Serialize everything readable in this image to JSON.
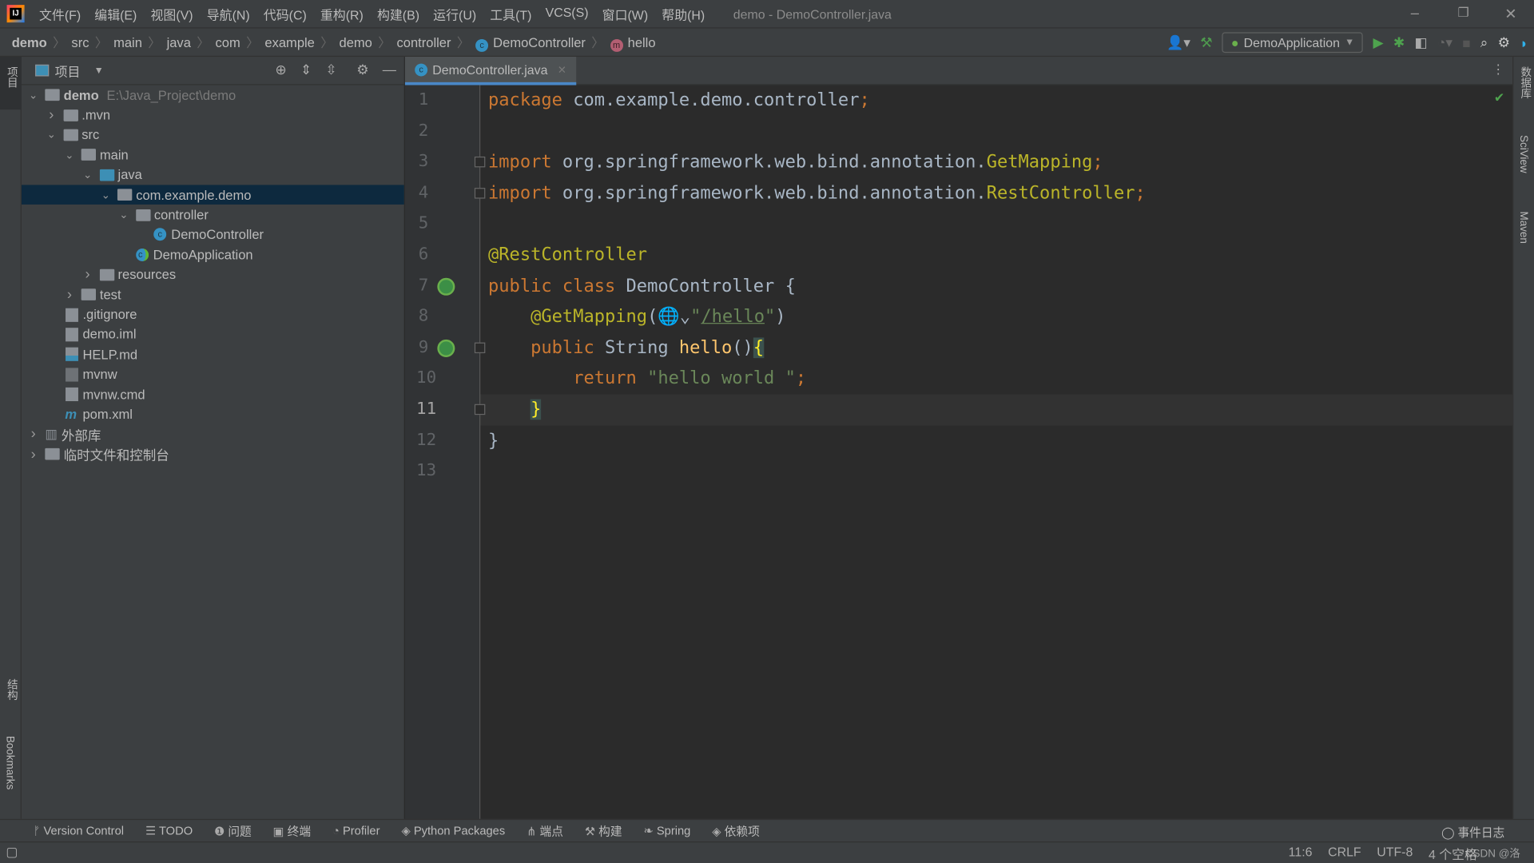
{
  "window": {
    "title": "demo - DemoController.java",
    "minimize": "–",
    "restore": "❐",
    "close": "✕"
  },
  "menu": [
    "文件(F)",
    "编辑(E)",
    "视图(V)",
    "导航(N)",
    "代码(C)",
    "重构(R)",
    "构建(B)",
    "运行(U)",
    "工具(T)",
    "VCS(S)",
    "窗口(W)",
    "帮助(H)"
  ],
  "breadcrumbs": [
    "demo",
    "src",
    "main",
    "java",
    "com",
    "example",
    "demo",
    "controller",
    "DemoController",
    "hello"
  ],
  "toolbar": {
    "run_config": "DemoApplication"
  },
  "left_stripe": {
    "project": "项目",
    "structure": "结构",
    "bookmarks": "Bookmarks"
  },
  "right_stripe": {
    "database": "数据库",
    "sciview": "SciView",
    "maven": "Maven"
  },
  "project_panel": {
    "title": "项目",
    "tree": [
      {
        "label": "demo",
        "path": "E:\\Java_Project\\demo",
        "depth": 0,
        "arrow": "open",
        "icon": "module-folder",
        "bold": true
      },
      {
        "label": ".mvn",
        "depth": 1,
        "arrow": "closed",
        "icon": "folder"
      },
      {
        "label": "src",
        "depth": 1,
        "arrow": "open",
        "icon": "folder"
      },
      {
        "label": "main",
        "depth": 2,
        "arrow": "open",
        "icon": "folder"
      },
      {
        "label": "java",
        "depth": 3,
        "arrow": "open",
        "icon": "source-folder"
      },
      {
        "label": "com.example.demo",
        "depth": 4,
        "arrow": "open",
        "icon": "package",
        "selected": true
      },
      {
        "label": "controller",
        "depth": 5,
        "arrow": "open",
        "icon": "package"
      },
      {
        "label": "DemoController",
        "depth": 6,
        "icon": "class"
      },
      {
        "label": "DemoApplication",
        "depth": 5,
        "icon": "spring-class"
      },
      {
        "label": "resources",
        "depth": 3,
        "arrow": "closed",
        "icon": "resources-folder"
      },
      {
        "label": "test",
        "depth": 2,
        "arrow": "closed",
        "icon": "folder"
      },
      {
        "label": ".gitignore",
        "depth": 1,
        "icon": "file"
      },
      {
        "label": "demo.iml",
        "depth": 1,
        "icon": "file"
      },
      {
        "label": "HELP.md",
        "depth": 1,
        "icon": "markdown"
      },
      {
        "label": "mvnw",
        "depth": 1,
        "icon": "shell"
      },
      {
        "label": "mvnw.cmd",
        "depth": 1,
        "icon": "file"
      },
      {
        "label": "pom.xml",
        "depth": 1,
        "icon": "maven"
      },
      {
        "label": "外部库",
        "depth": 0,
        "arrow": "closed",
        "icon": "library"
      },
      {
        "label": "临时文件和控制台",
        "depth": 0,
        "arrow": "closed",
        "icon": "scratch"
      }
    ]
  },
  "editor": {
    "tab": "DemoController.java",
    "current_line": 11,
    "lines": [
      [
        [
          "kw",
          "package "
        ],
        [
          "",
          "com.example.demo.controller"
        ],
        [
          "kw",
          ";"
        ]
      ],
      [],
      [
        [
          "kw",
          "import "
        ],
        [
          "",
          "org.springframework.web.bind.annotation."
        ],
        [
          "ann",
          "GetMapping"
        ],
        [
          "kw",
          ";"
        ]
      ],
      [
        [
          "kw",
          "import "
        ],
        [
          "",
          "org.springframework.web.bind.annotation."
        ],
        [
          "ann",
          "RestController"
        ],
        [
          "kw",
          ";"
        ]
      ],
      [],
      [
        [
          "ann",
          "@RestController"
        ]
      ],
      [
        [
          "kw",
          "public class "
        ],
        [
          "",
          "DemoController {"
        ]
      ],
      [
        [
          "",
          "    "
        ],
        [
          "ann",
          "@GetMapping"
        ],
        [
          "",
          "(🌐⌄"
        ],
        [
          "str",
          "\""
        ],
        [
          "strlink",
          "/hello"
        ],
        [
          "str",
          "\""
        ],
        [
          "",
          ")"
        ]
      ],
      [
        [
          "",
          "    "
        ],
        [
          "kw",
          "public "
        ],
        [
          "",
          "String "
        ],
        [
          "fn",
          "hello"
        ],
        [
          "",
          "()"
        ],
        [
          "br",
          "{"
        ]
      ],
      [
        [
          "",
          "        "
        ],
        [
          "kw",
          "return "
        ],
        [
          "str",
          "\"hello world \""
        ],
        [
          "kw",
          ";"
        ]
      ],
      [
        [
          "",
          "    "
        ],
        [
          "br",
          "}"
        ]
      ],
      [
        [
          "",
          "}"
        ]
      ],
      []
    ]
  },
  "bottom_tools": [
    "Version Control",
    "TODO",
    "问题",
    "终端",
    "Profiler",
    "Python Packages",
    "端点",
    "构建",
    "Spring",
    "依赖项"
  ],
  "bottom_tool_icons": [
    "branch-icon",
    "list-icon",
    "warning-icon",
    "terminal-icon",
    "profiler-icon",
    "layers-icon",
    "endpoints-icon",
    "hammer-icon",
    "spring-icon",
    "layers-icon"
  ],
  "event_log": "事件日志",
  "status": {
    "position": "11:6",
    "line_sep": "CRLF",
    "encoding": "UTF-8",
    "indent": "4 个空格"
  },
  "watermark": "CSDN @洛"
}
